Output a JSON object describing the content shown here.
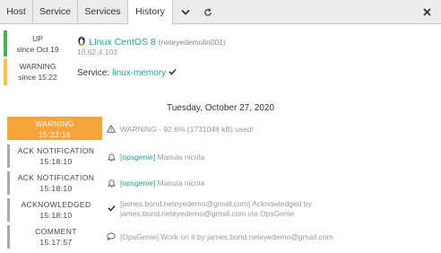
{
  "tabs": [
    {
      "label": "Host"
    },
    {
      "label": "Service"
    },
    {
      "label": "Services"
    },
    {
      "label": "History"
    }
  ],
  "tab_icons": {
    "dropdown": "chevron-down-icon",
    "refresh": "refresh-icon",
    "close": "close-icon"
  },
  "host": {
    "state": "UP",
    "state_since": "since Oct 19",
    "state_color": "#4caf50",
    "os_icon": "linux-penguin-icon",
    "name": "LInux CentOS 8",
    "hostname": "(neteyedemolin001)",
    "ip": "10.62.4.103"
  },
  "service": {
    "state": "WARNING",
    "state_since": "since 15:22",
    "state_color": "#f7c744",
    "label": "Service:",
    "name": "linux-memory",
    "check_icon": "check-icon"
  },
  "date_header": "Tuesday, October 27, 2020",
  "history": [
    {
      "type": "WARNING",
      "time": "15:22:16",
      "icon": "warning-triangle-icon",
      "message": "WARNING - 92.6% (1731048 kB) used!"
    },
    {
      "type": "ACK NOTIFICATION",
      "time": "15:18:10",
      "icon": "bell-icon",
      "tag": "[opsgenie]",
      "message": "Manula nicola"
    },
    {
      "type": "ACK NOTIFICATION",
      "time": "15:18:10",
      "icon": "bell-icon",
      "tag": "[opsgenie]",
      "message": "Manula nicola"
    },
    {
      "type": "ACKNOWLEDGED",
      "time": "15:18:10",
      "icon": "check-icon",
      "message_line1": "[james.bond.neteyedemo@gmail.com] Acknowledged by",
      "message_line2": "james.bond.neteyedemo@gmail.com via OpsGenie"
    },
    {
      "type": "COMMENT",
      "time": "15:17:57",
      "icon": "comment-icon",
      "message": "[OpsGenie] Work on it by james.bond.neteyedemo@gmail.com"
    }
  ],
  "colors": {
    "accent": "#2a9d8f",
    "warning": "#f7a43a",
    "up": "#4caf50",
    "warning_soft": "#f7c744"
  }
}
